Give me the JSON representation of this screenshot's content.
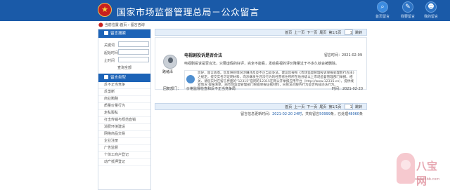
{
  "header": {
    "site_title": "国家市场监督管理总局－公众留言",
    "nav": [
      {
        "label": "首页留言",
        "icon": "search-icon"
      },
      {
        "label": "我要留言",
        "icon": "edit-icon"
      },
      {
        "label": "我的留言",
        "icon": "user-icon"
      }
    ]
  },
  "breadcrumb": "当前位置:首页 › 留言咨询",
  "sidebar": {
    "search_title": "留言搜索",
    "keyword_label": "关键词",
    "start_label": "起始时间",
    "end_label": "止时间",
    "query_button": "查询全部",
    "type_title": "留言类型",
    "types": [
      "反不正当竞争",
      "反垄断",
      "商业贿赂",
      "质量价量行为",
      "走私贩私",
      "打击传销与规范直销",
      "消费环境建设",
      "网络商品交易",
      "企业注册",
      "广告监督",
      "个体工商户登记",
      "动产抵押登记"
    ]
  },
  "pager": {
    "first": "首页",
    "prev": "上一页",
    "next": "下一页",
    "last": "尾页",
    "page_info": "第1/1页",
    "page_value": "1",
    "go": "跳转"
  },
  "message": {
    "author": "路绪泽",
    "title": "电视剧投诉是否合法",
    "time": "留言时间：2021-02-09",
    "body": "电视剧投诉是否合法，只要虚假的好评，完全不能看，发给看视的评价降量过于不多久就会被删除。",
    "reply_text": "您好，留言收悉。您反映的情况涉嫌违反反不正当竞争法。建议您按照《市场监督管理投诉举报处理暂行办法》之规定，提交实名可证明材料，向涉嫌发生违法行为的经营者住所所在地县级以上市场监督管理部门举报。相关、请您实时在留言界面的“12315”官网的12315在网公开举报应用平台（http://www.12315.cn），提供线索情况 提报清单，由市场监督管理部门根据举报证据材料，向依法对服务行为是否构成违法行为。",
    "reply_label": "回复部门：",
    "reply_dept": "价格监督检查和反不正当竞争局",
    "reply_time": "时间：2021-02-20"
  },
  "stats": {
    "updated_prefix": "留言信息更新时间：",
    "updated": "2021-02-20 24时",
    "count_prefix": "，共有留言",
    "count": "50999",
    "count_unit": "条",
    "replied_prefix": "，已处理",
    "replied": "48060",
    "replied_unit": "条"
  },
  "watermark": {
    "brand": "八宝网",
    "url": "www.8bb.com"
  }
}
